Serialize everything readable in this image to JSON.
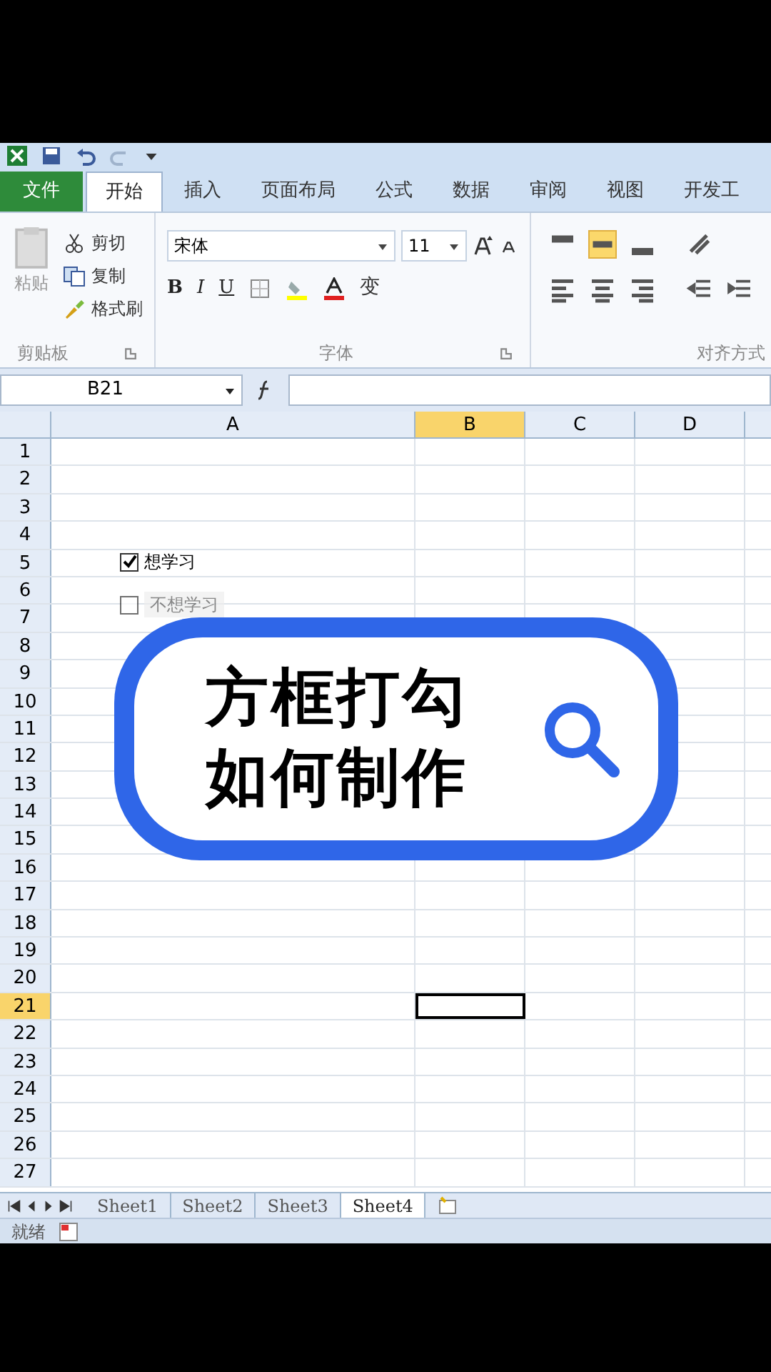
{
  "ribbon_tabs": [
    {
      "label": "文件",
      "kind": "file",
      "selected": false
    },
    {
      "label": "开始",
      "kind": "tab",
      "selected": true
    },
    {
      "label": "插入",
      "kind": "tab",
      "selected": false
    },
    {
      "label": "页面布局",
      "kind": "tab",
      "selected": false
    },
    {
      "label": "公式",
      "kind": "tab",
      "selected": false
    },
    {
      "label": "数据",
      "kind": "tab",
      "selected": false
    },
    {
      "label": "审阅",
      "kind": "tab",
      "selected": false
    },
    {
      "label": "视图",
      "kind": "tab",
      "selected": false
    },
    {
      "label": "开发工",
      "kind": "tab",
      "selected": false
    }
  ],
  "clipboard": {
    "paste": "粘贴",
    "cut": "剪切",
    "copy": "复制",
    "format_painter": "格式刷",
    "group_label": "剪贴板"
  },
  "font": {
    "name": "宋体",
    "size": "11",
    "buttons": [
      "B",
      "I",
      "U"
    ],
    "group_label": "字体",
    "emphasis": "变"
  },
  "alignment": {
    "group_label": "对齐方式"
  },
  "formula_bar": {
    "name_box": "B21"
  },
  "columns": [
    {
      "label": "A",
      "selected": false
    },
    {
      "label": "B",
      "selected": true
    },
    {
      "label": "C",
      "selected": false
    },
    {
      "label": "D",
      "selected": false
    }
  ],
  "rows": [
    {
      "label": "1",
      "selected": false
    },
    {
      "label": "2",
      "selected": false
    },
    {
      "label": "3",
      "selected": false
    },
    {
      "label": "4",
      "selected": false
    },
    {
      "label": "5",
      "selected": false
    },
    {
      "label": "6",
      "selected": false
    },
    {
      "label": "7",
      "selected": false
    },
    {
      "label": "8",
      "selected": false
    },
    {
      "label": "9",
      "selected": false
    },
    {
      "label": "10",
      "selected": false
    },
    {
      "label": "11",
      "selected": false
    },
    {
      "label": "12",
      "selected": false
    },
    {
      "label": "13",
      "selected": false
    },
    {
      "label": "14",
      "selected": false
    },
    {
      "label": "15",
      "selected": false
    },
    {
      "label": "16",
      "selected": false
    },
    {
      "label": "17",
      "selected": false
    },
    {
      "label": "18",
      "selected": false
    },
    {
      "label": "19",
      "selected": false
    },
    {
      "label": "20",
      "selected": false
    },
    {
      "label": "21",
      "selected": true
    },
    {
      "label": "22",
      "selected": false
    },
    {
      "label": "23",
      "selected": false
    },
    {
      "label": "24",
      "selected": false
    },
    {
      "label": "25",
      "selected": false
    },
    {
      "label": "26",
      "selected": false
    },
    {
      "label": "27",
      "selected": false
    }
  ],
  "checkboxes": [
    {
      "label": "想学习",
      "checked": true,
      "faded": false
    },
    {
      "label": "不想学习",
      "checked": false,
      "faded": true
    }
  ],
  "banner": {
    "lines": [
      "方框打勾",
      "如何制作"
    ]
  },
  "sheet_tabs": [
    {
      "label": "Sheet1",
      "selected": false
    },
    {
      "label": "Sheet2",
      "selected": false
    },
    {
      "label": "Sheet3",
      "selected": false
    },
    {
      "label": "Sheet4",
      "selected": true
    }
  ],
  "status_bar": {
    "text": "就绪"
  }
}
